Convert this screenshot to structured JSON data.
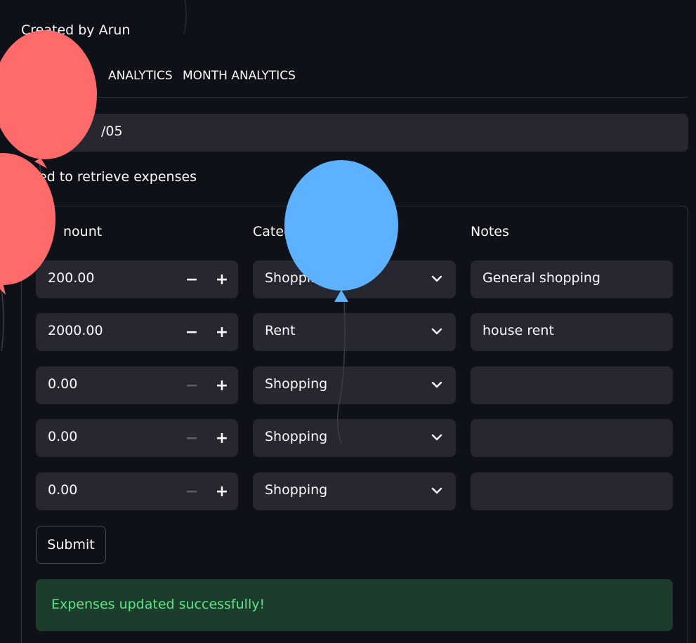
{
  "caption": "Created by Arun",
  "tabs": [
    "ANALYTICS",
    "MONTH ANALYTICS"
  ],
  "date_value": "/05",
  "info_text": "ed to retrieve expenses",
  "columns": {
    "amount": "nount",
    "category": "Categ",
    "notes": "Notes"
  },
  "rows": [
    {
      "amount": "200.00",
      "category": "Shoppin",
      "notes": "General shopping"
    },
    {
      "amount": "2000.00",
      "category": "Rent",
      "notes": "house rent"
    },
    {
      "amount": "0.00",
      "category": "Shopping",
      "notes": ""
    },
    {
      "amount": "0.00",
      "category": "Shopping",
      "notes": ""
    },
    {
      "amount": "0.00",
      "category": "Shopping",
      "notes": ""
    }
  ],
  "stepper": {
    "minus": "−",
    "plus": "+"
  },
  "submit_label": "Submit",
  "success_message": "Expenses updated successfully!",
  "colors": {
    "background": "#0e1117",
    "field": "#262730",
    "success_bg": "#1d3d2c",
    "success_text": "#5ce488",
    "balloon_red": "#ff6b6b",
    "balloon_blue": "#5eb1ff"
  }
}
